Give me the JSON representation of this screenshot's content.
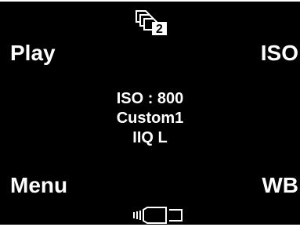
{
  "soft_keys": {
    "top_left": "Play",
    "top_right": "ISO",
    "bottom_left": "Menu",
    "bottom_right": "WB"
  },
  "status": {
    "iso": "ISO : 800",
    "profile": "Custom1",
    "format": "IIQ L"
  },
  "icons": {
    "top": "multi-storage-slot-2-icon",
    "bottom": "tethered-connection-icon"
  },
  "colors": {
    "background": "#000000",
    "text": "#ffffff"
  }
}
